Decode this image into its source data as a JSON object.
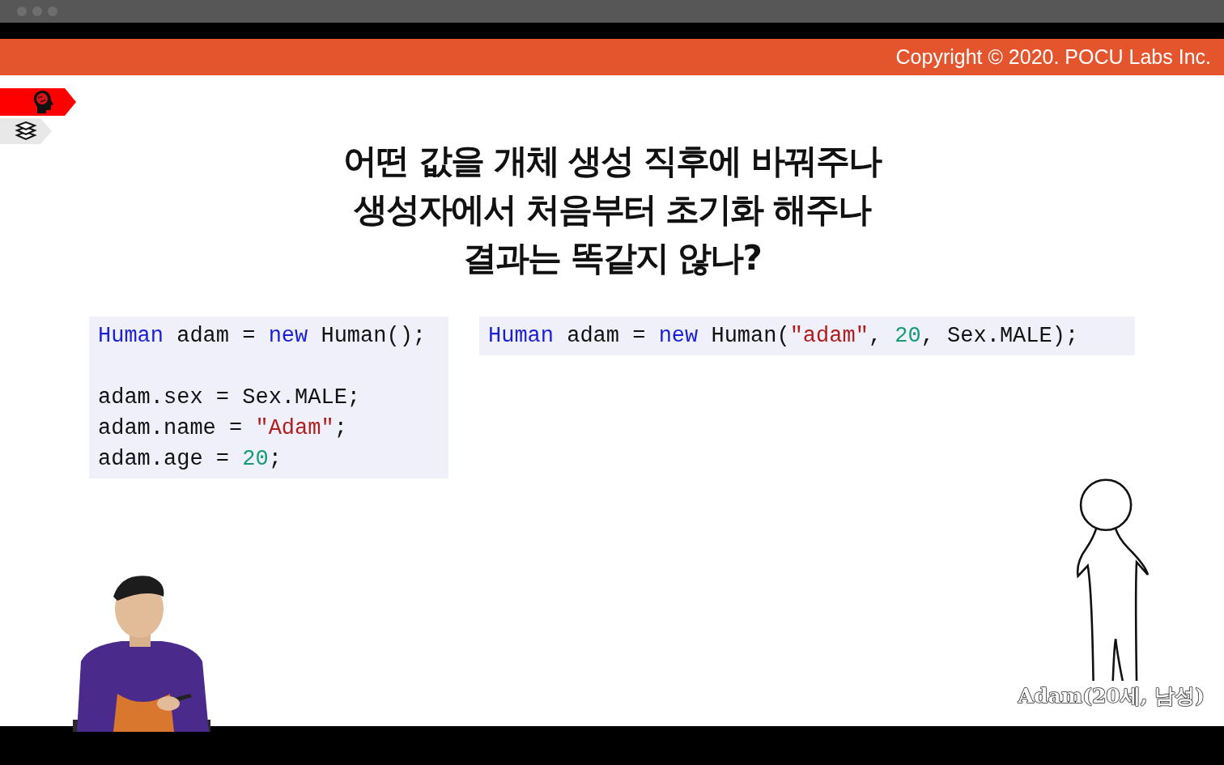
{
  "banner": {
    "copyright": "Copyright © 2020. POCU Labs Inc."
  },
  "nav_tabs": [
    {
      "kind": "brain",
      "selected": true
    },
    {
      "kind": "books",
      "selected": false
    }
  ],
  "title_lines": [
    "어떤 값을 개체 생성 직후에 바꿔주나",
    "생성자에서 처음부터 초기화 해주나",
    "결과는 똑같지 않나?"
  ],
  "code_blocks": [
    {
      "groups": [
        [
          [
            {
              "kind": "type",
              "text": "Human"
            },
            {
              "kind": "plain",
              "text": " adam = "
            },
            {
              "kind": "keyword",
              "text": "new"
            },
            {
              "kind": "plain",
              "text": " Human();"
            }
          ]
        ],
        [
          [
            {
              "kind": "plain",
              "text": "adam.sex = Sex.MALE;"
            }
          ],
          [
            {
              "kind": "plain",
              "text": "adam.name = "
            },
            {
              "kind": "string",
              "text": "\"Adam\""
            },
            {
              "kind": "plain",
              "text": ";"
            }
          ],
          [
            {
              "kind": "plain",
              "text": "adam.age = "
            },
            {
              "kind": "number",
              "text": "20"
            },
            {
              "kind": "plain",
              "text": ";"
            }
          ]
        ]
      ]
    },
    {
      "groups": [
        [
          [
            {
              "kind": "type",
              "text": "Human"
            },
            {
              "kind": "plain",
              "text": " adam = "
            },
            {
              "kind": "keyword",
              "text": "new"
            },
            {
              "kind": "plain",
              "text": " Human("
            },
            {
              "kind": "string",
              "text": "\"adam\""
            },
            {
              "kind": "plain",
              "text": ", "
            },
            {
              "kind": "number",
              "text": "20"
            },
            {
              "kind": "plain",
              "text": ", Sex.MALE);"
            }
          ]
        ]
      ]
    }
  ],
  "presenter": {
    "kind": "picture"
  },
  "character": {
    "caption": "Adam(20세, 남성)"
  }
}
